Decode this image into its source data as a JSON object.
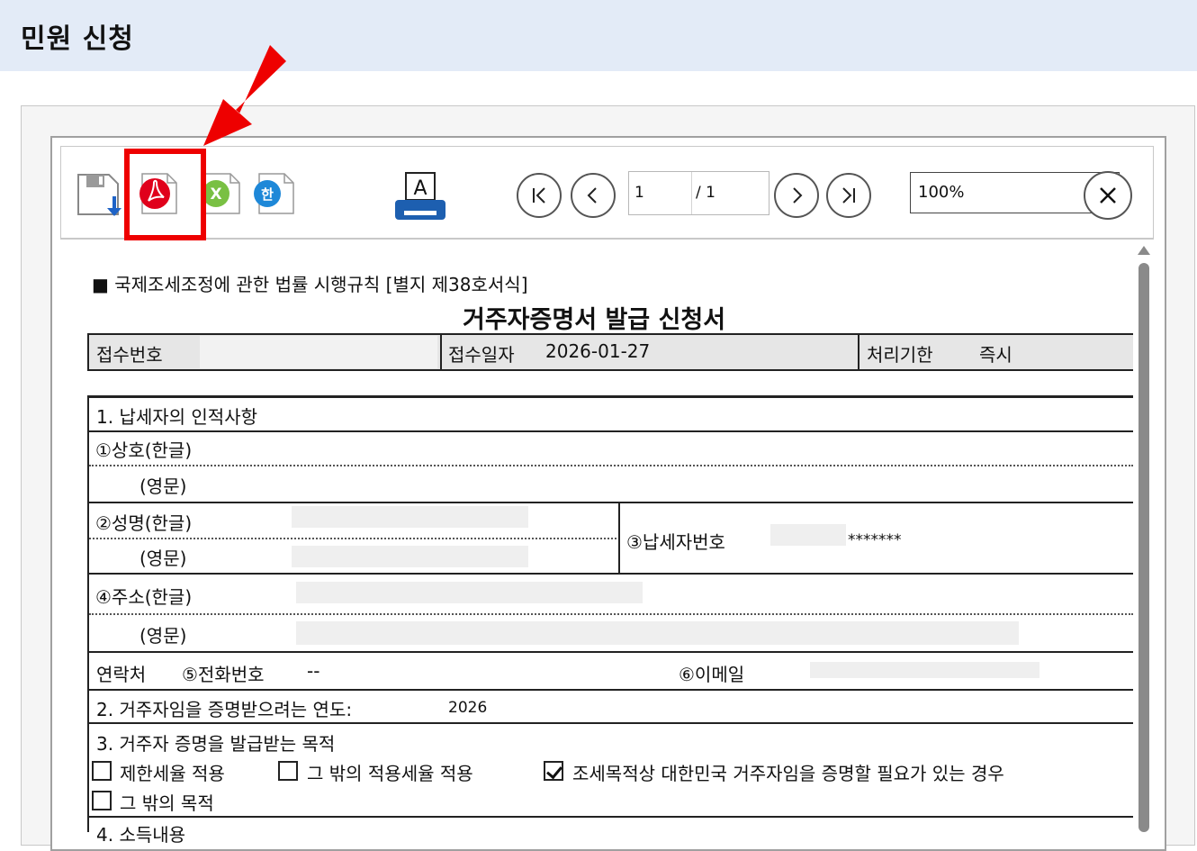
{
  "page": {
    "title": "민원 신청"
  },
  "toolbar": {
    "icons": [
      "save-icon",
      "pdf-icon",
      "excel-icon",
      "hwp-icon",
      "print-icon"
    ],
    "excel_letter": "X",
    "hwp_letter": "한",
    "print_letter": "A",
    "current_page": "1",
    "total_pages": "/ 1",
    "zoom": "100%"
  },
  "form": {
    "form_label": "■ 국제조세조정에 관한 법률 시행규칙 [별지 제38호서식]",
    "title": "거주자증명서 발급 신청서",
    "receipt_no_label": "접수번호",
    "receipt_date_label": "접수일자",
    "receipt_date": "2026-01-27",
    "deadline_label": "처리기한",
    "deadline_value": "즉시",
    "section1": "1. 납세자의 인적사항",
    "company_kr": "①상호(한글)",
    "company_en": "(영문)",
    "name_kr": "②성명(한글)",
    "name_en": "(영문)",
    "taxpayer_no_label": "③납세자번호",
    "taxpayer_no_masked": "*******",
    "address_kr": "④주소(한글)",
    "address_en": "(영문)",
    "contact_label": "연락처",
    "phone_label": "⑤전화번호",
    "phone_value": "--",
    "email_label": "⑥이메일",
    "section2": "2. 거주자임을 증명받으려는 연도:",
    "year": "2026",
    "section3": "3. 거주자 증명을 발급받는 목적",
    "purposes": [
      {
        "label": "제한세율 적용",
        "checked": false
      },
      {
        "label": "그 밖의 적용세율 적용",
        "checked": false
      },
      {
        "label": "조세목적상 대한민국 거주자임을 증명할 필요가 있는 경우",
        "checked": true
      },
      {
        "label": "그 밖의 목적",
        "checked": false
      }
    ],
    "section4": "4. 소득내용"
  },
  "colors": {
    "header_bg": "#e3ebf7",
    "highlight": "#ee0000",
    "pdf_red": "#e0001b",
    "excel_green": "#79c043",
    "hwp_blue": "#1e88d8",
    "print_blue": "#1d5fb0"
  }
}
